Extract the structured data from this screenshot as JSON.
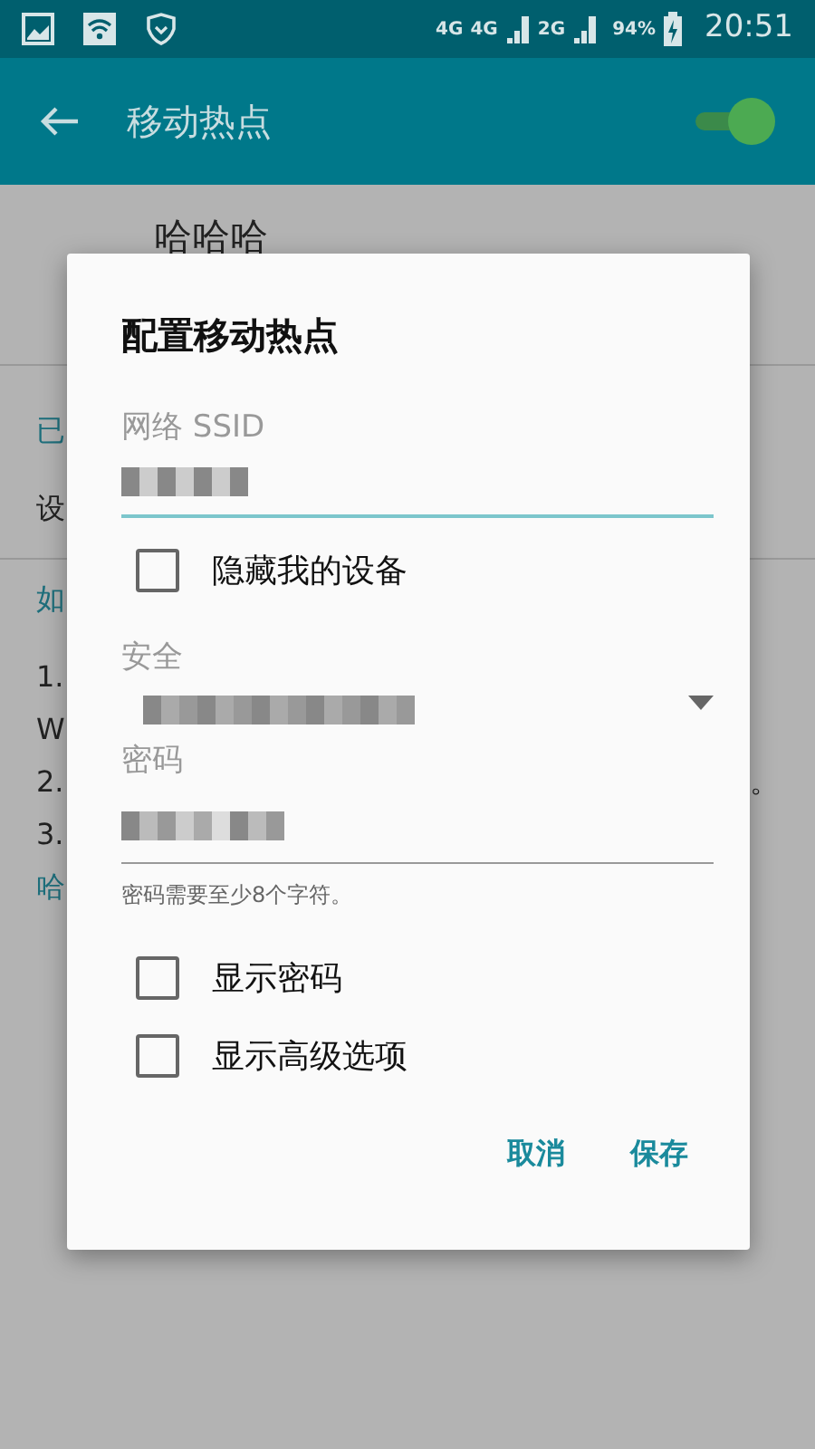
{
  "status_bar": {
    "network": "4G",
    "sim1": "4G",
    "sim2": "2G",
    "battery": "94%",
    "time": "20:51"
  },
  "app_bar": {
    "title": "移动热点",
    "hotspot_on": true
  },
  "background": {
    "name": "哈哈哈",
    "rows": [
      {
        "kind": "accent",
        "text": "已"
      },
      {
        "kind": "plain",
        "text": "设"
      },
      {
        "kind": "divider"
      },
      {
        "kind": "accent",
        "text": "如"
      },
      {
        "kind": "plain",
        "text": "1."
      },
      {
        "kind": "plain",
        "text": "W"
      },
      {
        "kind": "plain",
        "text": "2.",
        "tail": "。"
      },
      {
        "kind": "plain",
        "text": "3."
      },
      {
        "kind": "accent",
        "text": "哈"
      }
    ]
  },
  "dialog": {
    "title": "配置移动热点",
    "ssid_label": "网络 SSID",
    "hide_device": {
      "label": "隐藏我的设备",
      "checked": false
    },
    "security_label": "安全",
    "password_label": "密码",
    "password_hint": "密码需要至少8个字符。",
    "options": [
      {
        "label": "显示密码",
        "checked": false
      },
      {
        "label": "显示高级选项",
        "checked": false
      }
    ],
    "buttons": [
      "取消",
      "保存"
    ]
  }
}
